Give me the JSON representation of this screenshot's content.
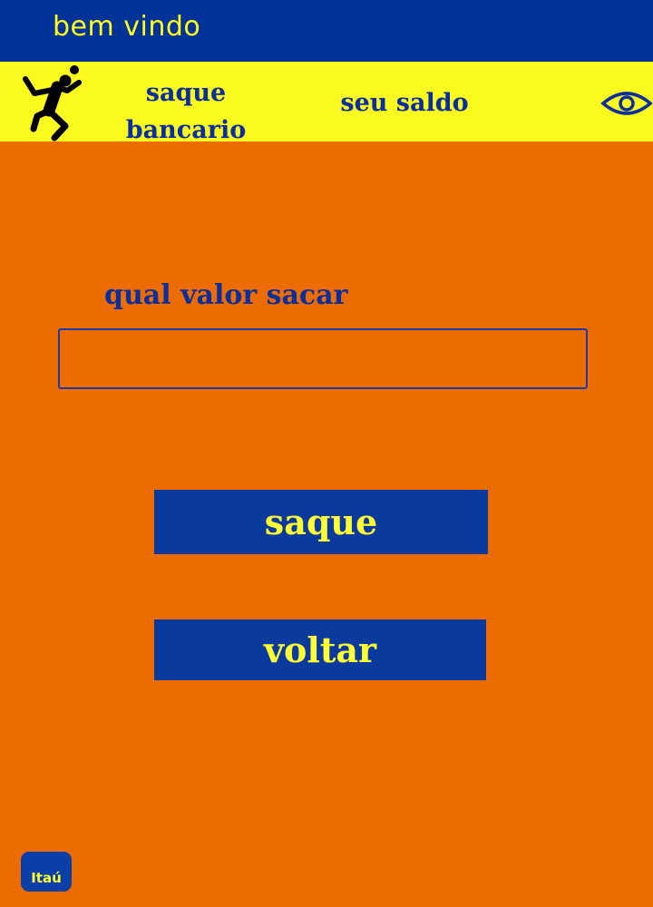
{
  "header": {
    "welcome_text": "bem vindo"
  },
  "nav": {
    "logo_icon": "volleyball-player-icon",
    "saque_line1": "saque",
    "saque_line2": "bancario",
    "saldo_label": "seu saldo",
    "eye_icon": "eye-icon"
  },
  "form": {
    "question": "qual valor sacar",
    "amount_value": "",
    "amount_placeholder": ""
  },
  "buttons": {
    "saque_label": "saque",
    "voltar_label": "voltar"
  },
  "footer": {
    "bank_logo_text": "Itaú"
  },
  "colors": {
    "background": "#EC6C00",
    "topbar": "#003399",
    "navbar": "#FAFA1E",
    "accent_text": "#FFFF33",
    "navy_text": "#0B2E9E"
  }
}
